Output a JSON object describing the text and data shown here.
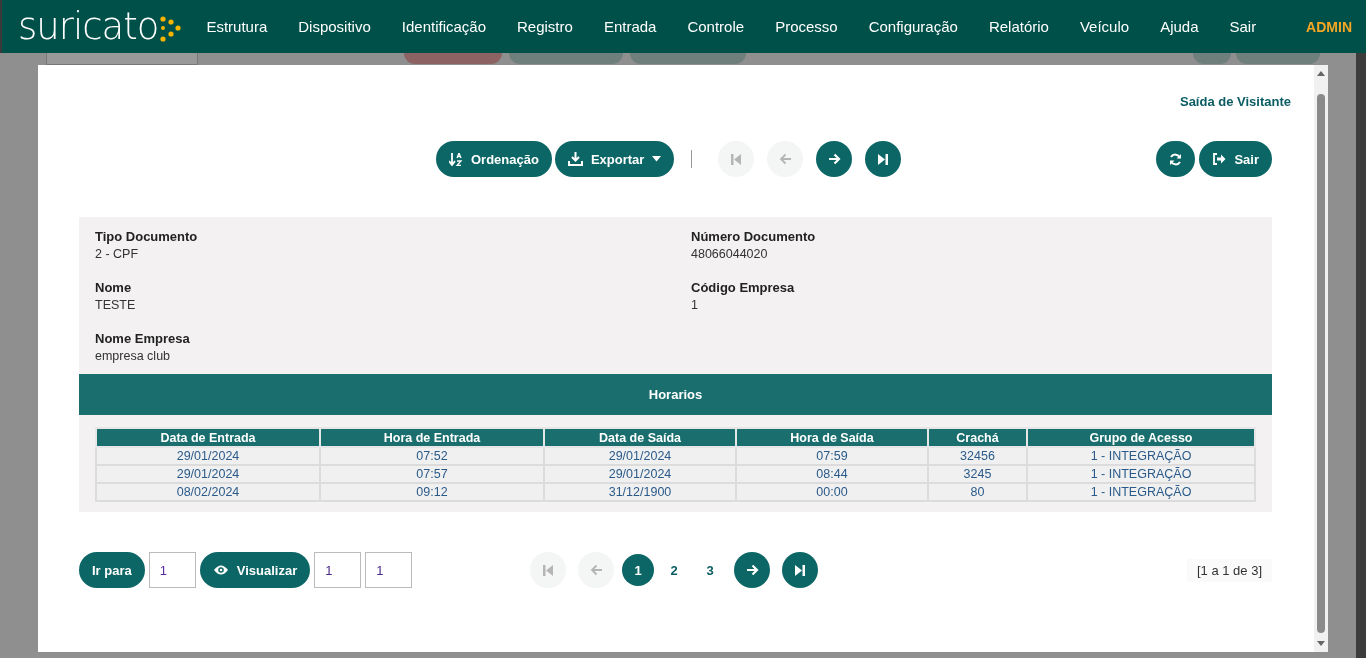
{
  "navbar": {
    "logo": "suricato",
    "menu": [
      "Estrutura",
      "Dispositivo",
      "Identificação",
      "Registro",
      "Entrada",
      "Controle",
      "Processo",
      "Configuração",
      "Relatório",
      "Veículo",
      "Ajuda",
      "Sair"
    ],
    "user": "ADMIN"
  },
  "modal": {
    "title": "Saída de Visitante",
    "toolbar": {
      "sort_button": "Ordenação",
      "export_button": "Exportar",
      "nav": [
        {
          "kind": "first",
          "disabled": true
        },
        {
          "kind": "prev",
          "disabled": true
        },
        {
          "kind": "next",
          "disabled": false
        },
        {
          "kind": "last",
          "disabled": false
        }
      ],
      "exit_button": "Sair"
    },
    "fields": [
      {
        "label": "Tipo Documento",
        "value": "2 - CPF"
      },
      {
        "label": "Número Documento",
        "value": "48066044020"
      },
      {
        "label": "Nome",
        "value": "TESTE"
      },
      {
        "label": "Código Empresa",
        "value": "1"
      },
      {
        "label": "Nome Empresa",
        "value": "empresa club"
      }
    ],
    "section_title": "Horarios",
    "table": {
      "columns": [
        "Data de Entrada",
        "Hora de Entrada",
        "Data de Saída",
        "Hora de Saída",
        "Crachá",
        "Grupo de Acesso"
      ],
      "rows": [
        [
          "29/01/2024",
          "07:52",
          "29/01/2024",
          "07:59",
          "32456",
          "1 - INTEGRAÇÃO"
        ],
        [
          "29/01/2024",
          "07:57",
          "29/01/2024",
          "08:44",
          "3245",
          "1 - INTEGRAÇÃO"
        ],
        [
          "08/02/2024",
          "09:12",
          "31/12/1900",
          "00:00",
          "80",
          "1 - INTEGRAÇÃO"
        ]
      ]
    },
    "footer": {
      "goto_button": "Ir para",
      "goto_value": "1",
      "view_button": "Visualizar",
      "view_values": [
        "1",
        "1"
      ],
      "nav": [
        {
          "kind": "first",
          "disabled": true
        },
        {
          "kind": "prev",
          "disabled": true
        },
        {
          "kind": "page",
          "label": "1",
          "selected": true
        },
        {
          "kind": "page",
          "label": "2",
          "selected": false
        },
        {
          "kind": "page",
          "label": "3",
          "selected": false
        },
        {
          "kind": "next",
          "disabled": false
        },
        {
          "kind": "last",
          "disabled": false
        }
      ],
      "range": "[1 a 1 de 3]"
    }
  }
}
